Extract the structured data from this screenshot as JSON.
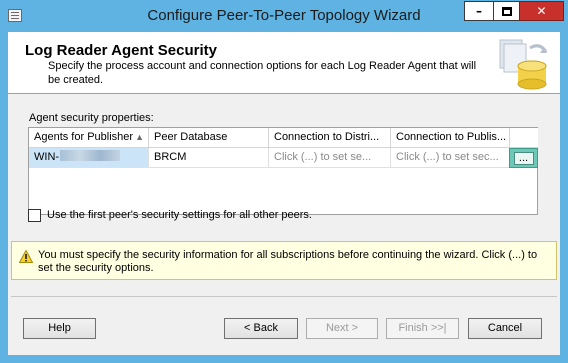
{
  "window": {
    "title": "Configure Peer-To-Peer Topology Wizard"
  },
  "header": {
    "title": "Log Reader Agent Security",
    "subtitle": "Specify the process account and connection options for each Log Reader Agent that will be created."
  },
  "grid": {
    "group_label": "Agent security properties:",
    "columns": [
      "Agents for Publisher",
      "Peer Database",
      "Connection to Distri...",
      "Connection to Publis..."
    ],
    "rows": [
      {
        "agent": "WIN-",
        "database": "BRCM",
        "dist_conn": "Click (...) to set se...",
        "pub_conn": "Click (...) to set sec...",
        "button": "..."
      }
    ]
  },
  "checkbox": {
    "label": "Use the first peer's security settings for all other peers.",
    "checked": false
  },
  "warning": {
    "text": "You must specify the security information for all subscriptions before continuing the wizard. Click (...) to set the security options."
  },
  "buttons": {
    "help": "Help",
    "back": "< Back",
    "next": "Next >",
    "finish": "Finish >>|",
    "cancel": "Cancel"
  },
  "colors": {
    "title_bar": "#5fb3e3",
    "close": "#c7302b",
    "selection": "#cce4f7",
    "highlight_button": "#6cc9b8",
    "warning_bg": "#ffffe1"
  }
}
